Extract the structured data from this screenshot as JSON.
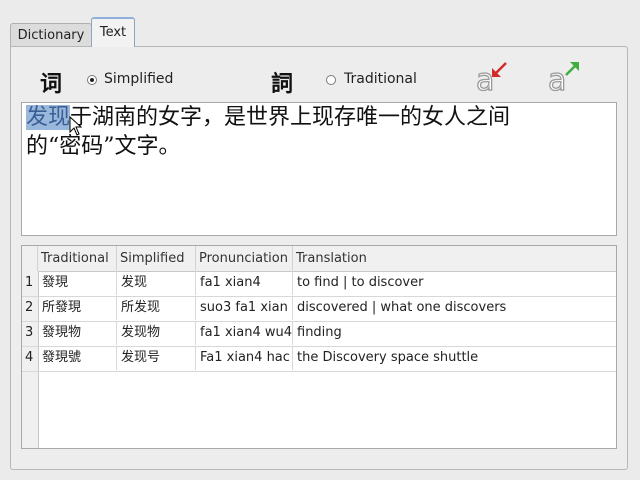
{
  "tabs": [
    {
      "label": "Dictionary",
      "active": false
    },
    {
      "label": "Text",
      "active": true
    }
  ],
  "mode": {
    "simplified_char": "词",
    "simplified_label": "Simplified",
    "simplified_selected": true,
    "traditional_char": "詞",
    "traditional_label": "Traditional",
    "traditional_selected": false
  },
  "font_buttons": {
    "decrease_icon": "font-decrease-icon",
    "increase_icon": "font-increase-icon",
    "decrease_color": "#d42a2a",
    "increase_color": "#3fae3f"
  },
  "editor": {
    "selected_text": "发现",
    "line1_rest": "于湖南的女字，是世界上现存唯一的女人之间",
    "line2": "的“密码”文字。"
  },
  "table": {
    "headers": [
      "Traditional",
      "Simplified",
      "Pronunciation",
      "Translation"
    ],
    "rows": [
      {
        "num": "1",
        "traditional": "發現",
        "simplified": "发现",
        "pronunciation": "fa1 xian4",
        "translation": "to find | to discover"
      },
      {
        "num": "2",
        "traditional": "所發現",
        "simplified": "所发现",
        "pronunciation": "suo3 fa1 xian",
        "translation": "discovered | what one discovers"
      },
      {
        "num": "3",
        "traditional": "發現物",
        "simplified": "发现物",
        "pronunciation": "fa1 xian4 wu4",
        "translation": "finding"
      },
      {
        "num": "4",
        "traditional": "發現號",
        "simplified": "发现号",
        "pronunciation": "Fa1 xian4 hac",
        "translation": "the Discovery space shuttle"
      }
    ]
  }
}
